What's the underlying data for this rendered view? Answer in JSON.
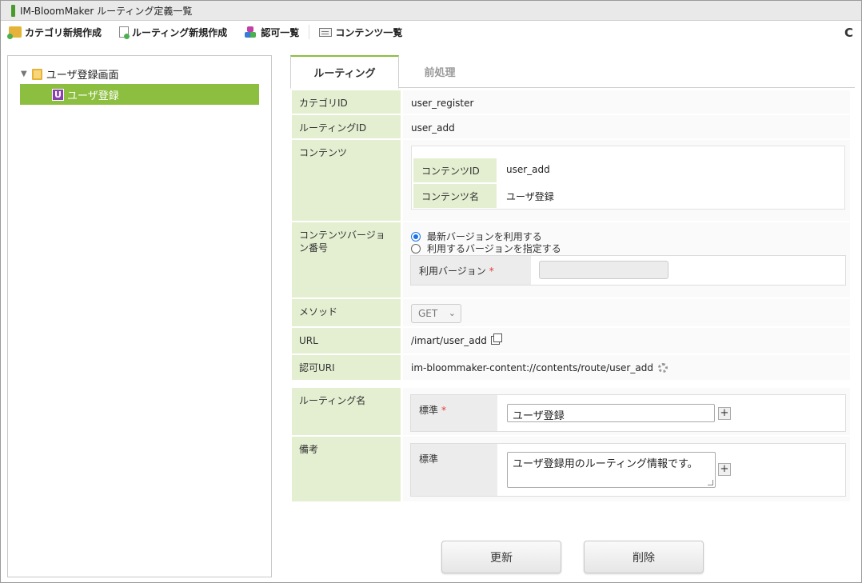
{
  "window": {
    "title": "IM-BloomMaker ルーティング定義一覧"
  },
  "toolbar": {
    "new_category": "カテゴリ新規作成",
    "new_routing": "ルーティング新規作成",
    "authorization_list": "認可一覧",
    "contents_list": "コンテンツ一覧",
    "refresh_icon": "C"
  },
  "tree": {
    "folder_label": "ユーザ登録画面",
    "leaf_badge": "U",
    "leaf_label": "ユーザ登録"
  },
  "tabs": [
    {
      "label": "ルーティング",
      "active": true
    },
    {
      "label": "前処理",
      "active": false
    }
  ],
  "form": {
    "category_id_label": "カテゴリID",
    "category_id_value": "user_register",
    "routing_id_label": "ルーティングID",
    "routing_id_value": "user_add",
    "contents_label": "コンテンツ",
    "contents_id_label": "コンテンツID",
    "contents_id_value": "user_add",
    "contents_name_label": "コンテンツ名",
    "contents_name_value": "ユーザ登録",
    "version_label": "コンテンツバージョン番号",
    "version_option_latest": "最新バージョンを利用する",
    "version_option_specify": "利用するバージョンを指定する",
    "version_selected": "latest",
    "use_version_label": "利用バージョン",
    "required_mark": "*",
    "use_version_value": "",
    "method_label": "メソッド",
    "method_value": "GET",
    "url_label": "URL",
    "url_value": "/imart/user_add",
    "auth_uri_label": "認可URI",
    "auth_uri_value": "im-bloommaker-content://contents/route/user_add",
    "routing_name_label": "ルーティング名",
    "standard_label": "標準",
    "routing_name_value": "ユーザ登録",
    "remarks_label": "備考",
    "remarks_value": "ユーザ登録用のルーティング情報です。",
    "plus_symbol": "+"
  },
  "buttons": {
    "update": "更新",
    "delete": "削除"
  },
  "colors": {
    "accent_green": "#8cbf3f",
    "label_bg": "#e4efd1",
    "badge_purple": "#8a3fb0"
  }
}
